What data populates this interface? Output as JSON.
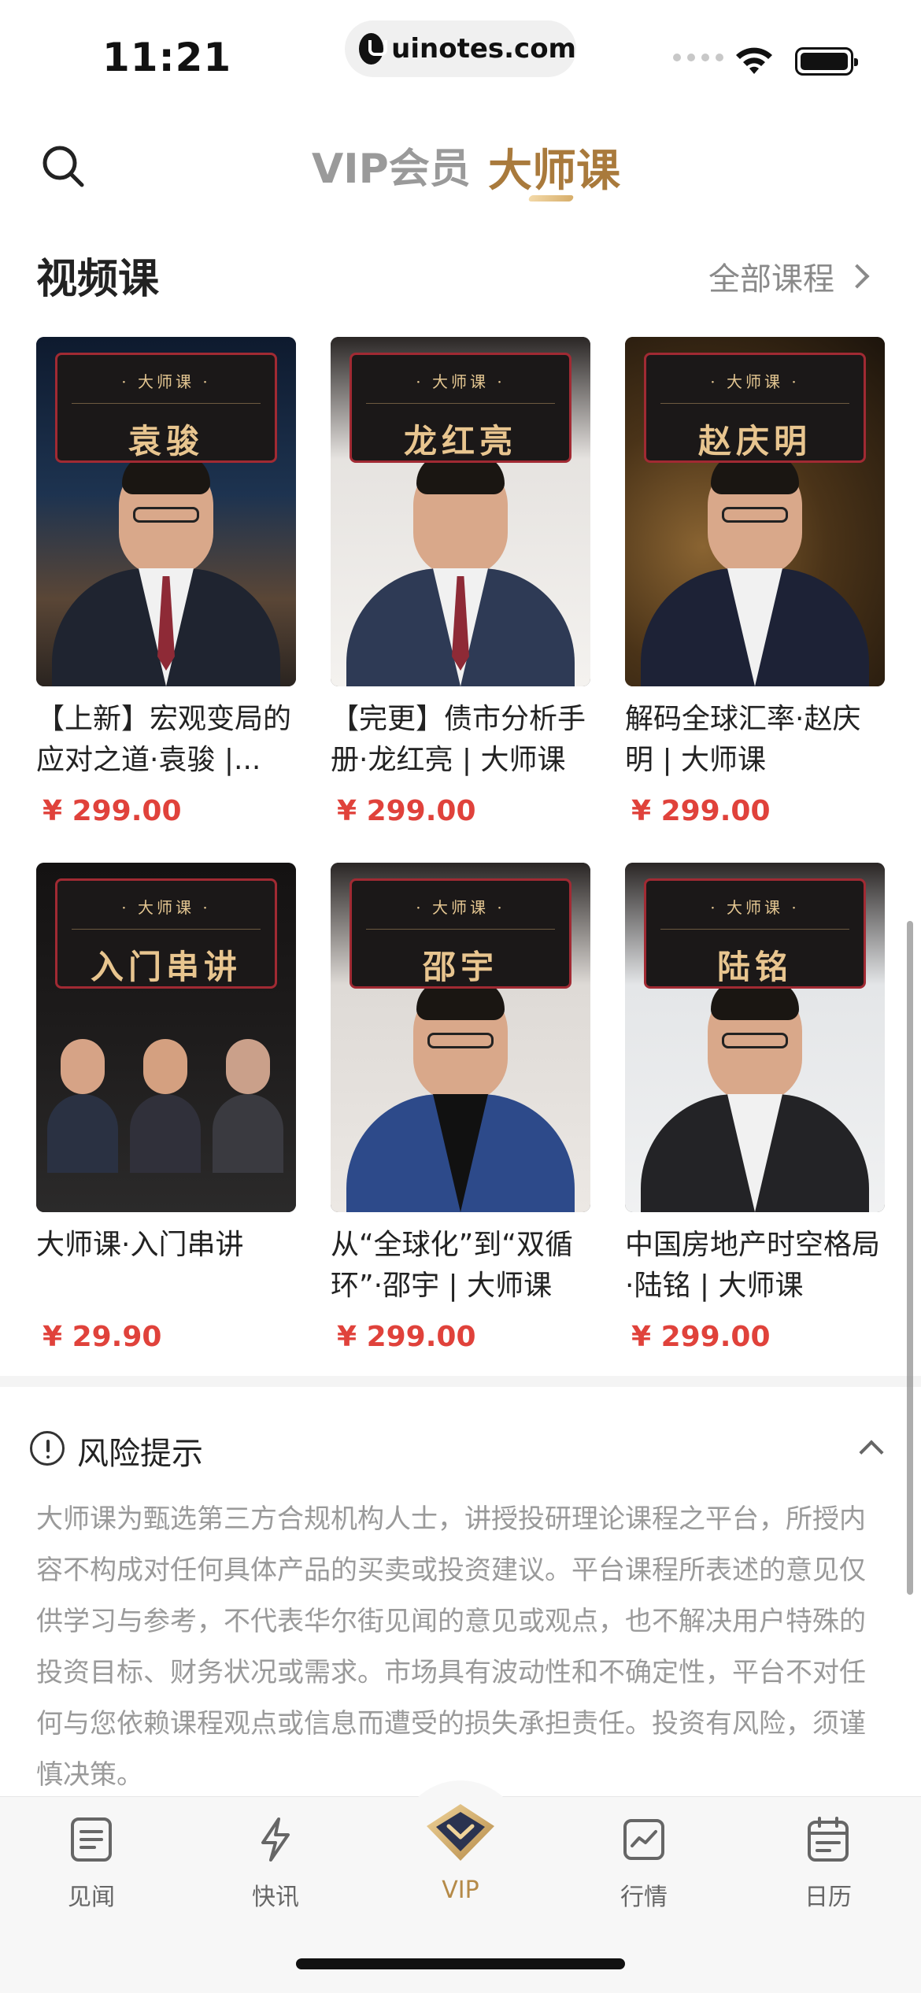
{
  "status_bar": {
    "time": "11:21",
    "url": "uinotes.com"
  },
  "header": {
    "tabs": [
      {
        "label": "VIP会员"
      },
      {
        "label": "大师课"
      }
    ]
  },
  "section": {
    "title": "视频课",
    "all_label": "全部课程"
  },
  "cards": [
    {
      "banner_small": "· 大师课 ·",
      "banner_name": "袁骏",
      "title": "【上新】宏观变局的应对之道·袁骏 |...",
      "price": "¥ 299.00"
    },
    {
      "banner_small": "· 大师课 ·",
      "banner_name": "龙红亮",
      "title": "【完更】债市分析手册·龙红亮 | 大师课",
      "price": "¥ 299.00"
    },
    {
      "banner_small": "· 大师课 ·",
      "banner_name": "赵庆明",
      "title": "解码全球汇率·赵庆明 | 大师课",
      "price": "¥ 299.00"
    },
    {
      "banner_small": "· 大师课 ·",
      "banner_name": "入门串讲",
      "title": "大师课·入门串讲",
      "price": "¥ 29.90"
    },
    {
      "banner_small": "· 大师课 ·",
      "banner_name": "邵宇",
      "title": "从“全球化”到“双循环”·邵宇 | 大师课",
      "price": "¥ 299.00"
    },
    {
      "banner_small": "· 大师课 ·",
      "banner_name": "陆铭",
      "title": "中国房地产时空格局·陆铭 | 大师课",
      "price": "¥ 299.00"
    }
  ],
  "risk": {
    "title": "风险提示",
    "text": "大师课为甄选第三方合规机构人士，讲授投研理论课程之平台，所授内容不构成对任何具体产品的买卖或投资建议。平台课程所表述的意见仅供学习与参考，不代表华尔街见闻的意见或观点，也不解决用户特殊的投资目标、财务状况或需求。市场具有波动性和不确定性，平台不对任何与您依赖课程观点或信息而遭受的损失承担责任。投资有风险，须谨慎决策。"
  },
  "tabbar": {
    "items": [
      {
        "label": "见闻",
        "icon": "news-icon"
      },
      {
        "label": "快讯",
        "icon": "flash-icon"
      },
      {
        "label": "VIP",
        "icon": "vip-diamond-icon"
      },
      {
        "label": "行情",
        "icon": "market-chart-icon"
      },
      {
        "label": "日历",
        "icon": "calendar-icon"
      }
    ]
  },
  "colors": {
    "accent_gold": "#a97a3c",
    "price_red": "#e0423b",
    "banner_border": "#a12a33",
    "banner_text": "#e8c58f"
  }
}
